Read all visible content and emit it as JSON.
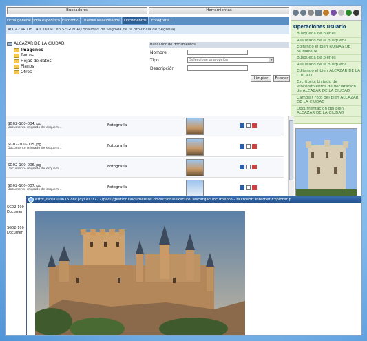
{
  "header": {
    "buscadores": "Buscadores",
    "herramientas": "Herramientas"
  },
  "tabs": [
    "Ficha general",
    "Ficha específica",
    "Escritorio",
    "Bienes relacionados",
    "Documentos",
    "Fotografía"
  ],
  "breadcrumb": "ALCAZAR DE LA CIUDAD en SEGOVIA(Localidad de Segovia de la provincia de Segovia)",
  "tree": {
    "root": "ALCAZAR DE LA CIUDAD",
    "children": [
      "Imagenes",
      "Textos",
      "Hojas de datos",
      "Planos",
      "Otros"
    ]
  },
  "search": {
    "title": "Buscador de documentos",
    "nombre_label": "Nombre",
    "tipo_label": "Tipo",
    "tipo_value": "Seleccione una opción",
    "descripcion_label": "Descripción",
    "limpiar": "Limpiar",
    "buscar": "Buscar"
  },
  "operations": {
    "title": "Operaciones usuario",
    "items": [
      "Búsqueda de bienes",
      "Resultado de la búsqueda",
      "Editando el bien RUINAS DE NUMANCIA",
      "Búsqueda de bienes",
      "Resultado de la búsqueda",
      "Editando el bien ALCAZAR DE LA CIUDAD",
      "Escritorio: Listado de Procedimientos de declaración de ALCAZAR DE LA CIUDAD",
      "Cambiar Foto del bien ALCAZAR DE LA CIUDAD",
      "Documentación del bien ALCAZAR DE LA CIUDAD"
    ]
  },
  "documents": [
    {
      "name": "SG02-100-004.jpg",
      "desc": "Documento migrado de esquem...",
      "type": "Fotografía"
    },
    {
      "name": "SG02-100-005.jpg",
      "desc": "Documento migrado de esquem...",
      "type": "Fotografía"
    },
    {
      "name": "SG02-100-006.jpg",
      "desc": "Documento migrado de esquem...",
      "type": "Fotografía"
    },
    {
      "name": "SG02-100-007.jpg",
      "desc": "Documento migrado de esquem...",
      "type": "Fotografía"
    }
  ],
  "sliver": [
    "SG02-100",
    "Documen",
    "SG02-100",
    "Documen"
  ],
  "popup": {
    "title": "http://sc01ul0615.cec.jcyl.es:7777/pacu/gestionDocumentos.do?action=executeDescargarDocumento - Microsoft Internet Explorer p"
  }
}
